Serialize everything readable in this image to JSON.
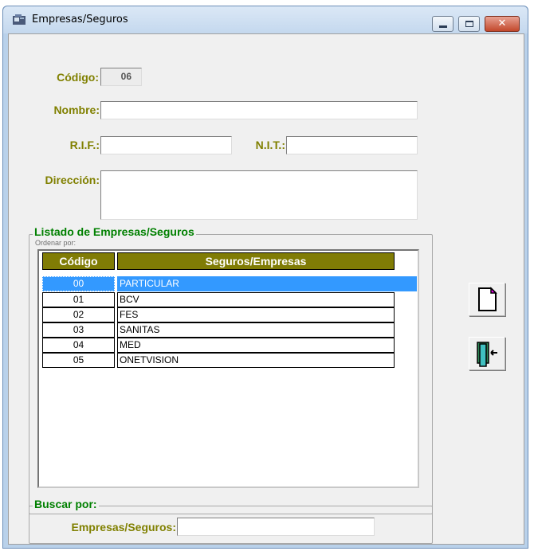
{
  "window": {
    "title": "Empresas/Seguros"
  },
  "form": {
    "codigo_label": "Código:",
    "codigo_value": "06",
    "nombre_label": "Nombre:",
    "nombre_value": "",
    "rif_label": "R.I.F.:",
    "rif_value": "",
    "nit_label": "N.I.T.:",
    "nit_value": "",
    "direccion_label": "Dirección:",
    "direccion_value": ""
  },
  "list_group": {
    "title": "Listado de Empresas/Seguros",
    "sort_caption": "Ordenar por:",
    "columns": [
      "Código",
      "Seguros/Empresas"
    ],
    "rows": [
      {
        "codigo": "00",
        "nombre": "PARTICULAR",
        "selected": true
      },
      {
        "codigo": "01",
        "nombre": "BCV"
      },
      {
        "codigo": "02",
        "nombre": "FES"
      },
      {
        "codigo": "03",
        "nombre": "SANITAS"
      },
      {
        "codigo": "04",
        "nombre": "MED"
      },
      {
        "codigo": "05",
        "nombre": "ONETVISION"
      }
    ]
  },
  "search_group": {
    "title": "Buscar por:",
    "label": "Empresas/Seguros:",
    "value": ""
  },
  "side_buttons": [
    {
      "icon": "new-document-icon"
    },
    {
      "icon": "exit-door-icon"
    }
  ],
  "colors": {
    "label_olive": "#808000",
    "group_title_green": "#008000",
    "header_bg": "#807c05",
    "selection_blue": "#3399ff"
  }
}
